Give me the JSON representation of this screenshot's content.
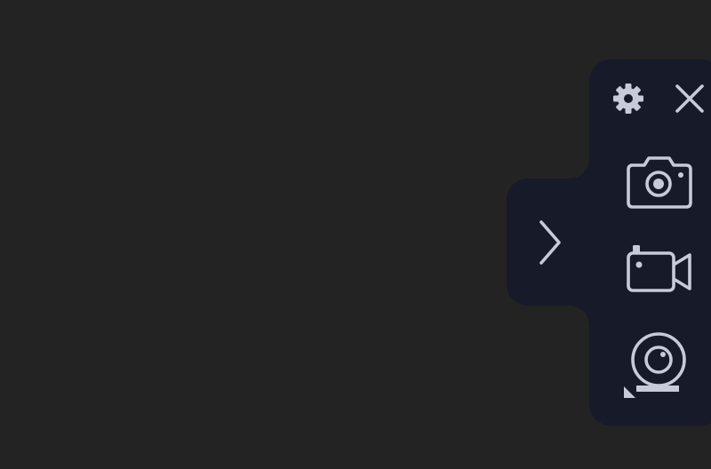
{
  "colors": {
    "background": "#232323",
    "panel": "#171a28",
    "icon": "#c7cad9"
  },
  "toolbar": {
    "settings_icon": "gear-icon",
    "close_icon": "close-icon",
    "expand_icon": "chevron-right-icon",
    "tools": [
      {
        "icon": "camera-icon"
      },
      {
        "icon": "video-camera-icon"
      },
      {
        "icon": "webcam-icon"
      }
    ]
  }
}
